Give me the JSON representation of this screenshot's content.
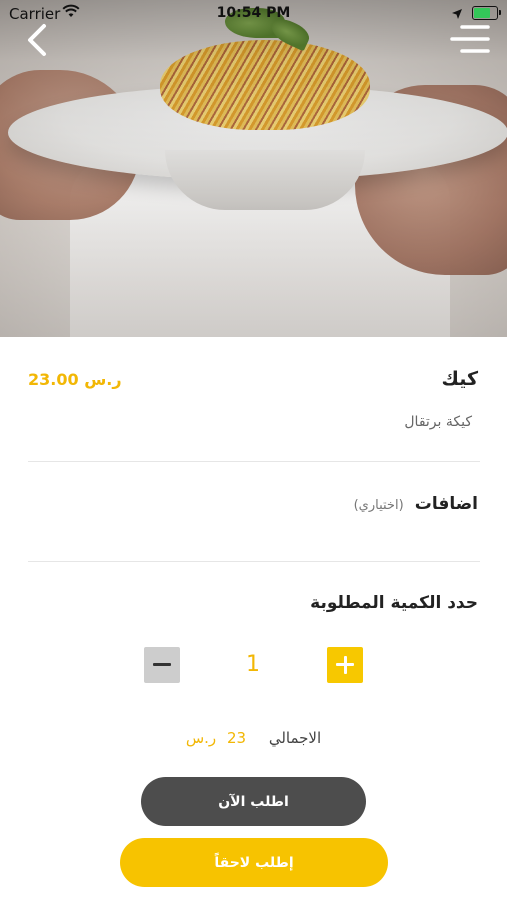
{
  "status_bar": {
    "carrier": "Carrier",
    "time": "10:54 PM"
  },
  "navigation": {
    "back_icon": "chevron-left-icon",
    "menu_icon": "menu-icon"
  },
  "product": {
    "name": "كيك",
    "price": "23.00 ر.س",
    "description": "كيكة برتقال"
  },
  "addons": {
    "title": "اضافات",
    "optional_label": "(اختياري)"
  },
  "quantity": {
    "title": "حدد الكمية المطلوبة",
    "value": "1"
  },
  "total": {
    "label": "الاجمالي",
    "amount": "23",
    "currency": "ر.س"
  },
  "actions": {
    "order_now": "اطلب الآن",
    "order_later": "إطلب لاحقاً"
  },
  "colors": {
    "accent": "#f7c300",
    "dark_button": "#4d4d4d",
    "stepper_minus": "#cdcdcd"
  }
}
